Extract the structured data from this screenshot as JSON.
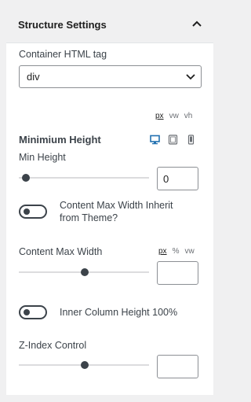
{
  "panel": {
    "title": "Structure Settings",
    "collapse_icon": "chevron-up-icon"
  },
  "html_tag": {
    "label": "Container HTML tag",
    "value": "div",
    "icon": "chevron-down-icon"
  },
  "min_height": {
    "units": [
      "px",
      "vw",
      "vh"
    ],
    "active_unit": "px",
    "title": "Minimium Height",
    "devices": [
      "desktop-icon",
      "tablet-icon",
      "mobile-icon"
    ],
    "active_device": "desktop-icon",
    "label": "Min Height",
    "value": "0",
    "slider_fraction": 0.05
  },
  "content_width_inherit": {
    "label_line1": "Content Max Width Inherit",
    "label_line2": "from Theme?",
    "enabled": false
  },
  "content_max_width": {
    "label": "Content Max Width",
    "units": [
      "px",
      "%",
      "vw"
    ],
    "active_unit": "px",
    "value": "",
    "slider_fraction": 0.5
  },
  "inner_column": {
    "label": "Inner Column Height 100%",
    "enabled": false
  },
  "z_index": {
    "label": "Z-Index Control",
    "value": "",
    "slider_fraction": 0.5
  },
  "colors": {
    "accent_active": "#2271b1",
    "control": "#3c434a",
    "panel_bg": "#ffffff",
    "page_bg": "#f0f0f1"
  }
}
